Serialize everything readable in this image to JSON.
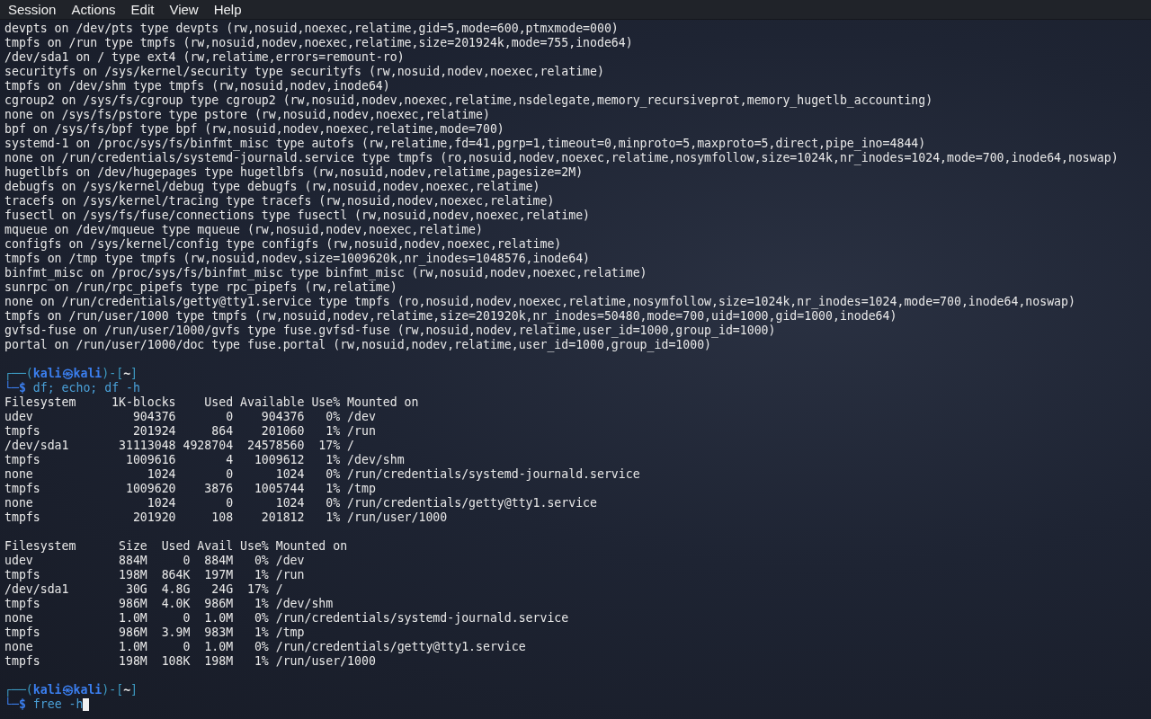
{
  "menu": [
    "Session",
    "Actions",
    "Edit",
    "View",
    "Help"
  ],
  "lines": [
    {
      "kind": "output",
      "text": "devpts on /dev/pts type devpts (rw,nosuid,noexec,relatime,gid=5,mode=600,ptmxmode=000)"
    },
    {
      "kind": "output",
      "text": "tmpfs on /run type tmpfs (rw,nosuid,nodev,noexec,relatime,size=201924k,mode=755,inode64)"
    },
    {
      "kind": "output",
      "text": "/dev/sda1 on / type ext4 (rw,relatime,errors=remount-ro)"
    },
    {
      "kind": "output",
      "text": "securityfs on /sys/kernel/security type securityfs (rw,nosuid,nodev,noexec,relatime)"
    },
    {
      "kind": "output",
      "text": "tmpfs on /dev/shm type tmpfs (rw,nosuid,nodev,inode64)"
    },
    {
      "kind": "output",
      "text": "cgroup2 on /sys/fs/cgroup type cgroup2 (rw,nosuid,nodev,noexec,relatime,nsdelegate,memory_recursiveprot,memory_hugetlb_accounting)"
    },
    {
      "kind": "output",
      "text": "none on /sys/fs/pstore type pstore (rw,nosuid,nodev,noexec,relatime)"
    },
    {
      "kind": "output",
      "text": "bpf on /sys/fs/bpf type bpf (rw,nosuid,nodev,noexec,relatime,mode=700)"
    },
    {
      "kind": "output",
      "text": "systemd-1 on /proc/sys/fs/binfmt_misc type autofs (rw,relatime,fd=41,pgrp=1,timeout=0,minproto=5,maxproto=5,direct,pipe_ino=4844)"
    },
    {
      "kind": "output",
      "text": "none on /run/credentials/systemd-journald.service type tmpfs (ro,nosuid,nodev,noexec,relatime,nosymfollow,size=1024k,nr_inodes=1024,mode=700,inode64,noswap)"
    },
    {
      "kind": "output",
      "text": "hugetlbfs on /dev/hugepages type hugetlbfs (rw,nosuid,nodev,relatime,pagesize=2M)"
    },
    {
      "kind": "output",
      "text": "debugfs on /sys/kernel/debug type debugfs (rw,nosuid,nodev,noexec,relatime)"
    },
    {
      "kind": "output",
      "text": "tracefs on /sys/kernel/tracing type tracefs (rw,nosuid,nodev,noexec,relatime)"
    },
    {
      "kind": "output",
      "text": "fusectl on /sys/fs/fuse/connections type fusectl (rw,nosuid,nodev,noexec,relatime)"
    },
    {
      "kind": "output",
      "text": "mqueue on /dev/mqueue type mqueue (rw,nosuid,nodev,noexec,relatime)"
    },
    {
      "kind": "output",
      "text": "configfs on /sys/kernel/config type configfs (rw,nosuid,nodev,noexec,relatime)"
    },
    {
      "kind": "output",
      "text": "tmpfs on /tmp type tmpfs (rw,nosuid,nodev,size=1009620k,nr_inodes=1048576,inode64)"
    },
    {
      "kind": "output",
      "text": "binfmt_misc on /proc/sys/fs/binfmt_misc type binfmt_misc (rw,nosuid,nodev,noexec,relatime)"
    },
    {
      "kind": "output",
      "text": "sunrpc on /run/rpc_pipefs type rpc_pipefs (rw,relatime)"
    },
    {
      "kind": "output",
      "text": "none on /run/credentials/getty@tty1.service type tmpfs (ro,nosuid,nodev,noexec,relatime,nosymfollow,size=1024k,nr_inodes=1024,mode=700,inode64,noswap)"
    },
    {
      "kind": "output",
      "text": "tmpfs on /run/user/1000 type tmpfs (rw,nosuid,nodev,relatime,size=201920k,nr_inodes=50480,mode=700,uid=1000,gid=1000,inode64)"
    },
    {
      "kind": "output",
      "text": "gvfsd-fuse on /run/user/1000/gvfs type fuse.gvfsd-fuse (rw,nosuid,nodev,relatime,user_id=1000,group_id=1000)"
    },
    {
      "kind": "output",
      "text": "portal on /run/user/1000/doc type fuse.portal (rw,nosuid,nodev,relatime,user_id=1000,group_id=1000)"
    },
    {
      "kind": "blank"
    },
    {
      "kind": "prompt",
      "open": "┌──(",
      "user": "kali",
      "at": "㉿",
      "host": "kali",
      "mid": ")-[",
      "dir": "~",
      "close": "]",
      "sigil": "└─$",
      "command": "df; echo; df -h",
      "cursor": false
    },
    {
      "kind": "output",
      "text": "Filesystem     1K-blocks    Used Available Use% Mounted on"
    },
    {
      "kind": "output",
      "text": "udev              904376       0    904376   0% /dev"
    },
    {
      "kind": "output",
      "text": "tmpfs             201924     864    201060   1% /run"
    },
    {
      "kind": "output",
      "text": "/dev/sda1       31113048 4928704  24578560  17% /"
    },
    {
      "kind": "output",
      "text": "tmpfs            1009616       4   1009612   1% /dev/shm"
    },
    {
      "kind": "output",
      "text": "none                1024       0      1024   0% /run/credentials/systemd-journald.service"
    },
    {
      "kind": "output",
      "text": "tmpfs            1009620    3876   1005744   1% /tmp"
    },
    {
      "kind": "output",
      "text": "none                1024       0      1024   0% /run/credentials/getty@tty1.service"
    },
    {
      "kind": "output",
      "text": "tmpfs             201920     108    201812   1% /run/user/1000"
    },
    {
      "kind": "blank"
    },
    {
      "kind": "output",
      "text": "Filesystem      Size  Used Avail Use% Mounted on"
    },
    {
      "kind": "output",
      "text": "udev            884M     0  884M   0% /dev"
    },
    {
      "kind": "output",
      "text": "tmpfs           198M  864K  197M   1% /run"
    },
    {
      "kind": "output",
      "text": "/dev/sda1        30G  4.8G   24G  17% /"
    },
    {
      "kind": "output",
      "text": "tmpfs           986M  4.0K  986M   1% /dev/shm"
    },
    {
      "kind": "output",
      "text": "none            1.0M     0  1.0M   0% /run/credentials/systemd-journald.service"
    },
    {
      "kind": "output",
      "text": "tmpfs           986M  3.9M  983M   1% /tmp"
    },
    {
      "kind": "output",
      "text": "none            1.0M     0  1.0M   0% /run/credentials/getty@tty1.service"
    },
    {
      "kind": "output",
      "text": "tmpfs           198M  108K  198M   1% /run/user/1000"
    },
    {
      "kind": "blank"
    },
    {
      "kind": "prompt",
      "open": "┌──(",
      "user": "kali",
      "at": "㉿",
      "host": "kali",
      "mid": ")-[",
      "dir": "~",
      "close": "]",
      "sigil": "└─$",
      "command": "free -h",
      "cursor": true
    }
  ]
}
